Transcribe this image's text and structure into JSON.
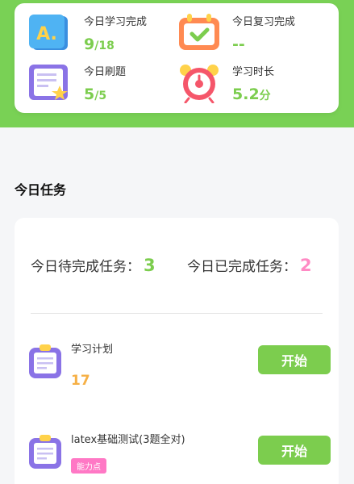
{
  "stats": [
    {
      "label": "今日学习完成",
      "value_main": "9",
      "value_sub": "/18",
      "icon": "letter-a-book-icon"
    },
    {
      "label": "今日复习完成",
      "value_main": "--",
      "value_sub": "",
      "icon": "calendar-check-icon"
    },
    {
      "label": "今日刷题",
      "value_main": "5",
      "value_sub": "/5",
      "icon": "notebook-star-icon"
    },
    {
      "label": "学习时长",
      "value_main": "5.2",
      "value_sub": "分",
      "icon": "alarm-clock-icon"
    }
  ],
  "section_title": "今日任务",
  "summary": {
    "pending_label": "今日待完成任务：",
    "pending_count": "3",
    "done_label": "今日已完成任务：",
    "done_count": "2"
  },
  "tasks": [
    {
      "name": "学习计划",
      "count": "17",
      "button": "开始",
      "icon": "clipboard-icon"
    },
    {
      "name": "latex基础测试(3题全对)",
      "tag": "能力点",
      "button": "开始",
      "icon": "clipboard-icon"
    }
  ],
  "colors": {
    "brand_green": "#7ccd4e",
    "band_green": "#79d155",
    "pink": "#ff8ac4",
    "orange": "#f6b046",
    "tag_pink": "#ff78c5"
  }
}
